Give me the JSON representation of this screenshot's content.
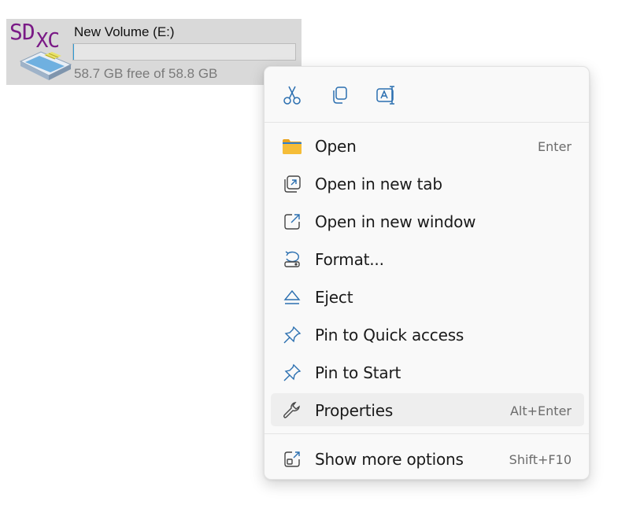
{
  "drive": {
    "name": "New Volume (E:)",
    "free_text": "58.7 GB free of 58.8 GB",
    "used_fraction": 0.002,
    "logo_text_sd": "SD",
    "logo_text_xc": "XC"
  },
  "colors": {
    "accent": "#2e9bd6",
    "logo": "#7a1a86",
    "folder": "#f2b531"
  },
  "toolbar": [
    {
      "name": "cut",
      "icon": "scissors-icon"
    },
    {
      "name": "copy",
      "icon": "copy-icon"
    },
    {
      "name": "rename",
      "icon": "rename-icon"
    }
  ],
  "menu": {
    "items": [
      {
        "label": "Open",
        "shortcut": "Enter",
        "icon": "folder-icon"
      },
      {
        "label": "Open in new tab",
        "shortcut": "",
        "icon": "open-new-tab-icon"
      },
      {
        "label": "Open in new window",
        "shortcut": "",
        "icon": "open-new-window-icon"
      },
      {
        "label": "Format...",
        "shortcut": "",
        "icon": "format-icon"
      },
      {
        "label": "Eject",
        "shortcut": "",
        "icon": "eject-icon"
      },
      {
        "label": "Pin to Quick access",
        "shortcut": "",
        "icon": "pin-icon"
      },
      {
        "label": "Pin to Start",
        "shortcut": "",
        "icon": "pin-icon"
      },
      {
        "label": "Properties",
        "shortcut": "Alt+Enter",
        "icon": "wrench-icon"
      }
    ],
    "more": {
      "label": "Show more options",
      "shortcut": "Shift+F10",
      "icon": "show-more-icon"
    }
  }
}
